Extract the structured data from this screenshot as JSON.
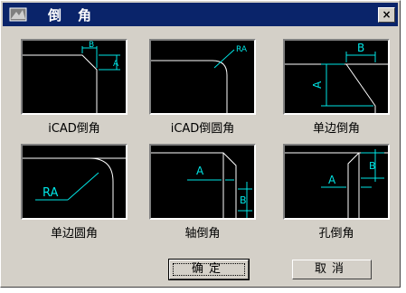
{
  "window": {
    "title": "倒角",
    "close_label": "×"
  },
  "options": [
    {
      "label": "iCAD倒角",
      "dim_labels": [
        "B",
        "A"
      ]
    },
    {
      "label": "iCAD倒圆角",
      "dim_labels": [
        "RA"
      ]
    },
    {
      "label": "单边倒角",
      "dim_labels": [
        "B",
        "A"
      ]
    },
    {
      "label": "单边圆角",
      "dim_labels": [
        "RA"
      ]
    },
    {
      "label": "轴倒角",
      "dim_labels": [
        "A",
        "B"
      ]
    },
    {
      "label": "孔倒角",
      "dim_labels": [
        "A",
        "B"
      ]
    }
  ],
  "buttons": {
    "ok": "确定",
    "cancel": "取消"
  },
  "colors": {
    "titlebar": "#0a246a",
    "dialog_bg": "#d4d0c8",
    "preview_bg": "#000000",
    "geometry": "#ffffff",
    "dimension": "#00e5e5",
    "dim_text": "#00ff00"
  }
}
